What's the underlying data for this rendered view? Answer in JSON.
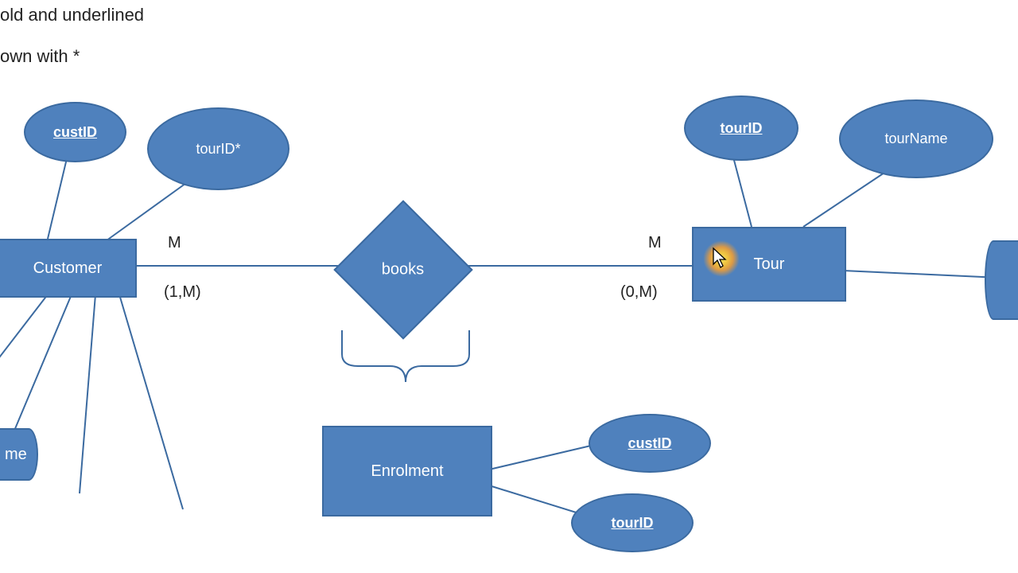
{
  "notes": {
    "line1": "old and underlined",
    "line2": "own with *"
  },
  "entities": {
    "customer": "Customer",
    "tour": "Tour",
    "enrolment": "Enrolment"
  },
  "relationship": {
    "books": "books"
  },
  "attributes": {
    "custID": "custID",
    "tourID_fk": "tourID*",
    "tourID": "tourID",
    "tourName": "tourName",
    "enrol_custID": "custID",
    "enrol_tourID": "tourID",
    "left_cut": "me"
  },
  "cardinalities": {
    "cust_side_top": "M",
    "cust_side_bottom": "(1,M)",
    "tour_side_top": "M",
    "tour_side_bottom": "(0,M)"
  },
  "chart_data": {
    "type": "er-diagram",
    "entities": [
      {
        "name": "Customer",
        "attributes": [
          {
            "name": "custID",
            "pk": true
          },
          {
            "name": "tourID",
            "fk": true
          },
          {
            "name": "me",
            "partial": true
          }
        ]
      },
      {
        "name": "Tour",
        "attributes": [
          {
            "name": "tourID",
            "pk": true
          },
          {
            "name": "tourName"
          }
        ]
      },
      {
        "name": "Enrolment",
        "associative_for": "books",
        "attributes": [
          {
            "name": "custID",
            "pk": true
          },
          {
            "name": "tourID",
            "pk": true
          }
        ]
      }
    ],
    "relationships": [
      {
        "name": "books",
        "between": [
          "Customer",
          "Tour"
        ],
        "cardinality": {
          "Customer": "M (1,M)",
          "Tour": "M (0,M)"
        },
        "associative_entity": "Enrolment"
      }
    ]
  }
}
